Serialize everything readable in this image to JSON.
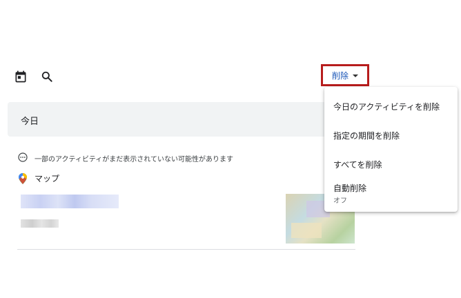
{
  "toolbar": {
    "calendar_icon": "calendar-icon",
    "search_icon": "search-icon",
    "delete_label": "削除",
    "highlight_color": "#b71c1c",
    "delete_color": "#1a56b8"
  },
  "date_header": {
    "label": "今日"
  },
  "notice": {
    "icon": "more-horizontal-circle-icon",
    "text": "一部のアクティビティがまだ表示されていない可能性があります"
  },
  "maps_entry": {
    "icon": "maps-pin-icon",
    "label": "マップ"
  },
  "delete_menu": {
    "items": [
      {
        "label": "今日のアクティビティを削除"
      },
      {
        "label": "指定の期間を削除"
      },
      {
        "label": "すべてを削除"
      },
      {
        "label": "自動削除",
        "status": "オフ"
      }
    ]
  }
}
